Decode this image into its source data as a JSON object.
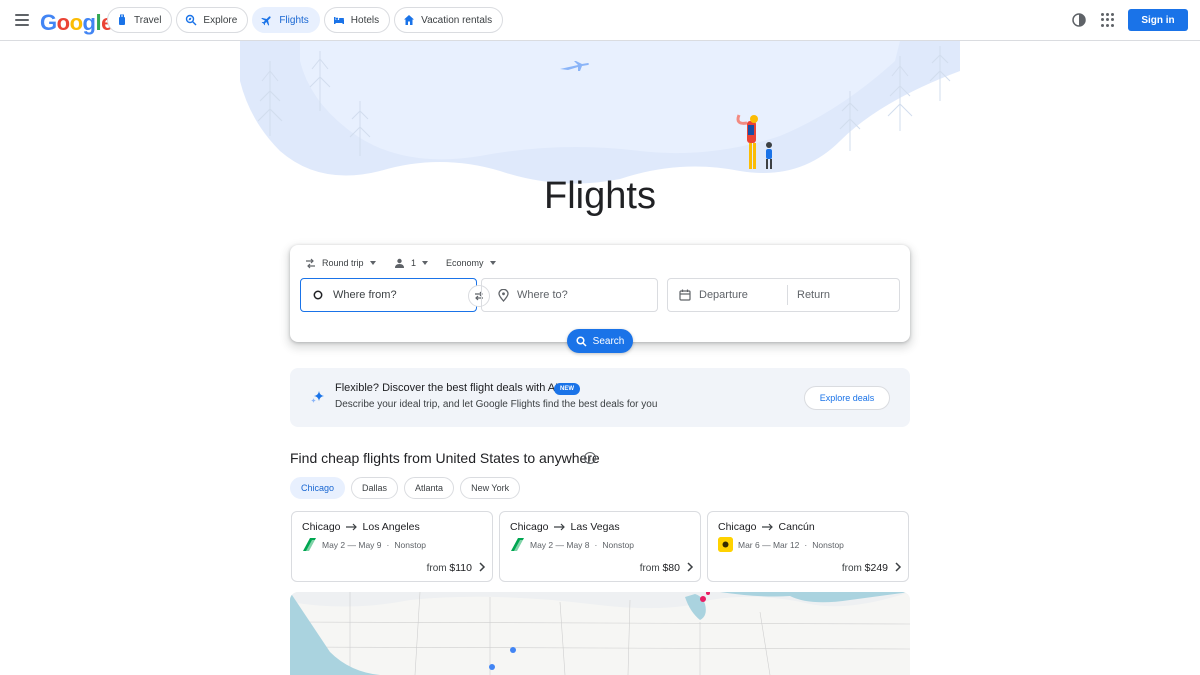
{
  "header": {
    "logo_letters": [
      "G",
      "o",
      "o",
      "g",
      "l",
      "e"
    ],
    "tabs": [
      {
        "label": "Travel",
        "icon": "travel-icon",
        "active": false
      },
      {
        "label": "Explore",
        "icon": "explore-icon",
        "active": false
      },
      {
        "label": "Flights",
        "icon": "flight-icon",
        "active": true
      },
      {
        "label": "Hotels",
        "icon": "hotel-icon",
        "active": false
      },
      {
        "label": "Vacation rentals",
        "icon": "vacation-rental-icon",
        "active": false
      }
    ],
    "sign_in": "Sign in"
  },
  "hero": {
    "title": "Flights"
  },
  "search": {
    "trip_type": "Round trip",
    "passengers": "1",
    "cabin_class": "Economy",
    "from_placeholder": "Where from?",
    "to_placeholder": "Where to?",
    "departure_placeholder": "Departure",
    "return_placeholder": "Return",
    "search_label": "Search"
  },
  "ai_banner": {
    "title": "Flexible? Discover the best flight deals with AI",
    "badge": "NEW",
    "description": "Describe your ideal trip, and let Google Flights find the best deals for you",
    "button": "Explore deals"
  },
  "deals": {
    "title": "Find cheap flights from United States to anywhere",
    "chips": [
      {
        "label": "Chicago",
        "active": true
      },
      {
        "label": "Dallas",
        "active": false
      },
      {
        "label": "Atlanta",
        "active": false
      },
      {
        "label": "New York",
        "active": false
      }
    ],
    "cards": [
      {
        "from": "Chicago",
        "to": "Los Angeles",
        "dates": "May 2 — May 9",
        "stops": "Nonstop",
        "price_prefix": "from",
        "price": "$110",
        "airline_color": "#00a651"
      },
      {
        "from": "Chicago",
        "to": "Las Vegas",
        "dates": "May 2 — May 8",
        "stops": "Nonstop",
        "price_prefix": "from",
        "price": "$80",
        "airline_color": "#00a651"
      },
      {
        "from": "Chicago",
        "to": "Cancún",
        "dates": "Mar 6 — Mar 12",
        "stops": "Nonstop",
        "price_prefix": "from",
        "price": "$249",
        "airline_color": "#ffd200"
      }
    ]
  },
  "colors": {
    "accent": "#1a73e8",
    "active_tab_bg": "#e8f0fe",
    "banner_bg": "#f1f4f9"
  }
}
